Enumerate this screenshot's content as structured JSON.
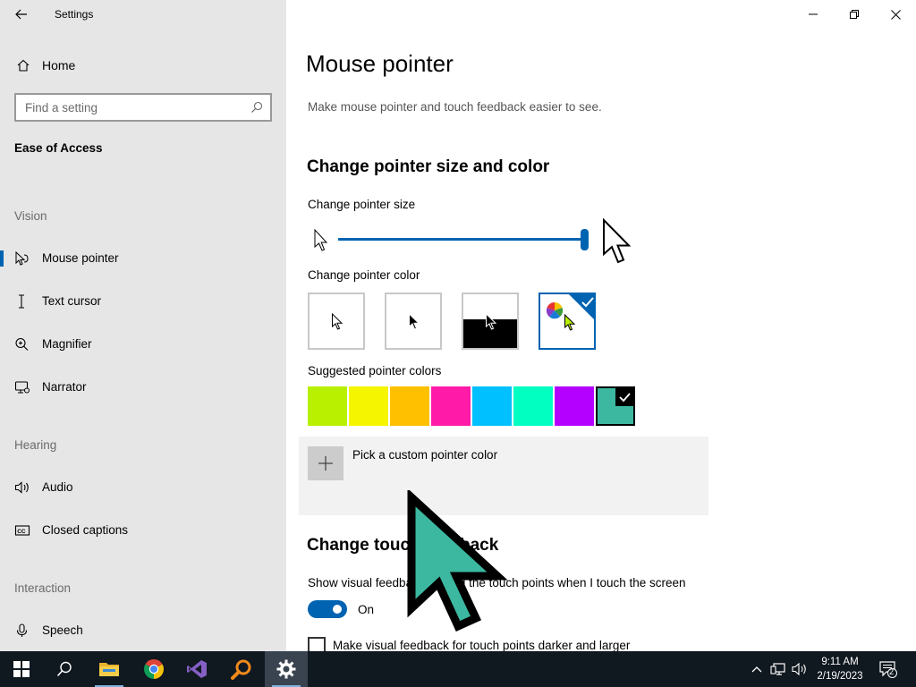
{
  "window": {
    "title": "Settings"
  },
  "sidebar": {
    "home_label": "Home",
    "search_placeholder": "Find a setting",
    "section_title": "Ease of Access",
    "groups": {
      "vision": "Vision",
      "hearing": "Hearing",
      "interaction": "Interaction"
    },
    "items": [
      {
        "label": "Mouse pointer",
        "icon": "mouse-pointer-icon",
        "active": true
      },
      {
        "label": "Text cursor",
        "icon": "text-cursor-icon",
        "active": false
      },
      {
        "label": "Magnifier",
        "icon": "magnifier-icon",
        "active": false
      },
      {
        "label": "Narrator",
        "icon": "narrator-icon",
        "active": false
      },
      {
        "label": "Audio",
        "icon": "audio-icon",
        "active": false
      },
      {
        "label": "Closed captions",
        "icon": "closed-captions-icon",
        "active": false
      },
      {
        "label": "Speech",
        "icon": "speech-icon",
        "active": false
      }
    ]
  },
  "main": {
    "title": "Mouse pointer",
    "description": "Make mouse pointer and touch feedback easier to see.",
    "size_color_heading": "Change pointer size and color",
    "pointer_size_label": "Change pointer size",
    "pointer_size_level": 1.0,
    "pointer_color_label": "Change pointer color",
    "pointer_color_options": [
      "white",
      "black",
      "inverted",
      "custom"
    ],
    "pointer_color_selected": "custom",
    "suggested_label": "Suggested pointer colors",
    "suggested_colors": [
      "#b8f000",
      "#f5f500",
      "#ffc000",
      "#ff1aa8",
      "#00c0ff",
      "#00ffc0",
      "#b400ff",
      "#3cb8a0"
    ],
    "suggested_selected_index": 7,
    "custom_color_label": "Pick a custom pointer color",
    "touch_heading": "Change touch feedback",
    "touch_feedback_label": "Show visual feedback around the touch points when I touch the screen",
    "toggle_state": "On",
    "darker_label": "Make visual feedback for touch points darker and larger"
  },
  "colors": {
    "accent": "#0063b1",
    "sidebar_bg": "#e6e6e6",
    "cursor_fill": "#3cb8a0",
    "taskbar_bg": "#101820"
  },
  "taskbar": {
    "time": "9:11 AM",
    "date": "2/19/2023",
    "notification_count": "2",
    "apps": [
      "windows-start-icon",
      "search-icon",
      "file-explorer-icon",
      "chrome-icon",
      "visual-studio-icon",
      "magnifier-app-icon",
      "settings-icon"
    ]
  }
}
